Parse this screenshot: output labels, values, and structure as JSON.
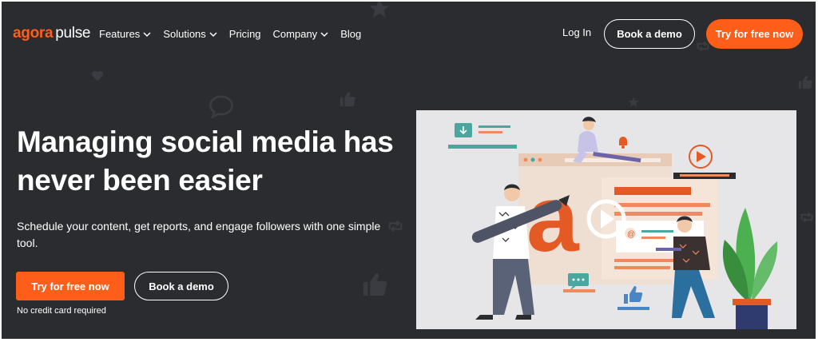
{
  "brand": {
    "name_part1": "agora",
    "name_part2": "pulse",
    "accent": "#ff5e1a",
    "background": "#2a2c30"
  },
  "nav": {
    "items": [
      {
        "label": "Features",
        "dropdown": true
      },
      {
        "label": "Solutions",
        "dropdown": true
      },
      {
        "label": "Pricing",
        "dropdown": false
      },
      {
        "label": "Company",
        "dropdown": true
      },
      {
        "label": "Blog",
        "dropdown": false
      }
    ],
    "login": "Log In",
    "book_demo": "Book a demo",
    "try_free": "Try for free now"
  },
  "hero": {
    "headline": "Managing social media has never been easier",
    "subtext": "Schedule your content, get reports, and engage followers with one simple tool.",
    "cta_primary": "Try for free now",
    "cta_secondary": "Book a demo",
    "note": "No credit card required"
  },
  "illustration": {
    "letter": "a",
    "email_symbol": "@"
  }
}
